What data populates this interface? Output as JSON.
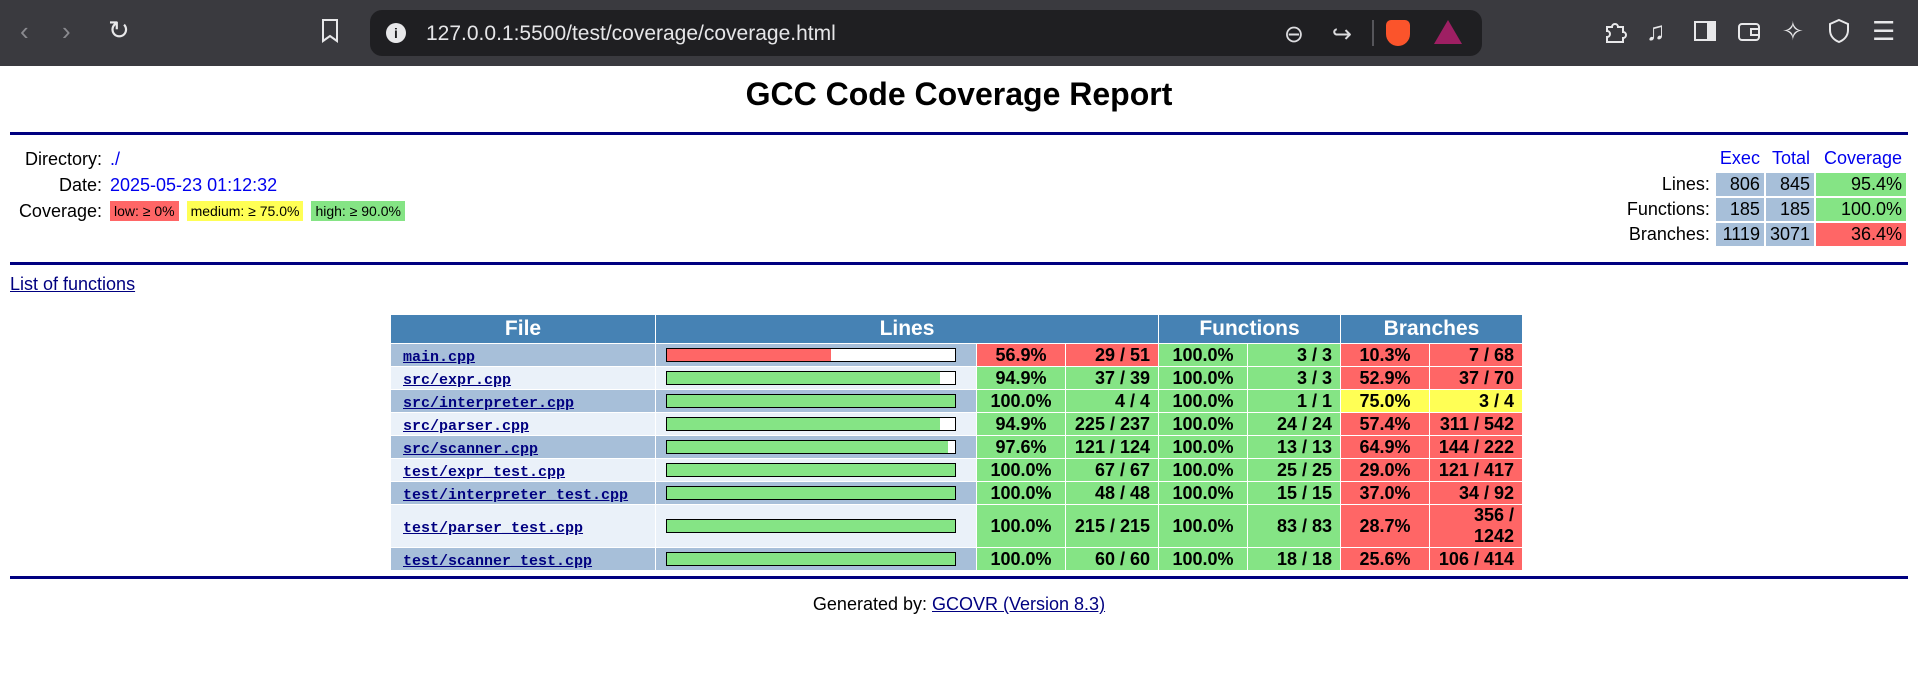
{
  "browser": {
    "url": "127.0.0.1:5500/test/coverage/coverage.html",
    "icons": [
      "back-icon",
      "forward-icon",
      "reload-icon",
      "bookmark-icon",
      "info-icon",
      "zoom-out-icon",
      "share-icon",
      "brave-shields-icon",
      "brave-rewards-icon",
      "extensions-icon",
      "media-icon",
      "sidebar-icon",
      "wallet-icon",
      "leo-ai-icon",
      "vpn-icon",
      "menu-icon"
    ]
  },
  "report": {
    "title": "GCC Code Coverage Report",
    "directory_label": "Directory:",
    "directory": "./",
    "date_label": "Date:",
    "date": "2025-05-23 01:12:32",
    "coverage_label": "Coverage:",
    "legend": {
      "low": "low: ≥ 0%",
      "medium": "medium: ≥ 75.0%",
      "high": "high: ≥ 90.0%"
    },
    "summary": {
      "headers": [
        "Exec",
        "Total",
        "Coverage"
      ],
      "rows": [
        {
          "label": "Lines:",
          "exec": "806",
          "total": "845",
          "coverage": "95.4%",
          "level": "hi"
        },
        {
          "label": "Functions:",
          "exec": "185",
          "total": "185",
          "coverage": "100.0%",
          "level": "hi"
        },
        {
          "label": "Branches:",
          "exec": "1119",
          "total": "3071",
          "coverage": "36.4%",
          "level": "lo"
        }
      ]
    },
    "list_of_functions": "List of functions",
    "table": {
      "headers": [
        "File",
        "Lines",
        "Functions",
        "Branches"
      ],
      "rows": [
        {
          "file": "main.cpp",
          "line_fraction": 0.569,
          "lines_pct": "56.9%",
          "lines": "29 / 51",
          "lines_level": "lo",
          "func_pct": "100.0%",
          "funcs": "3 / 3",
          "func_level": "hi",
          "br_pct": "10.3%",
          "branches": "7 / 68",
          "br_level": "lo"
        },
        {
          "file": "src/expr.cpp",
          "line_fraction": 0.949,
          "lines_pct": "94.9%",
          "lines": "37 / 39",
          "lines_level": "hi",
          "func_pct": "100.0%",
          "funcs": "3 / 3",
          "func_level": "hi",
          "br_pct": "52.9%",
          "branches": "37 / 70",
          "br_level": "lo"
        },
        {
          "file": "src/interpreter.cpp",
          "line_fraction": 1.0,
          "lines_pct": "100.0%",
          "lines": "4 / 4",
          "lines_level": "hi",
          "func_pct": "100.0%",
          "funcs": "1 / 1",
          "func_level": "hi",
          "br_pct": "75.0%",
          "branches": "3 / 4",
          "br_level": "md"
        },
        {
          "file": "src/parser.cpp",
          "line_fraction": 0.949,
          "lines_pct": "94.9%",
          "lines": "225 / 237",
          "lines_level": "hi",
          "func_pct": "100.0%",
          "funcs": "24 / 24",
          "func_level": "hi",
          "br_pct": "57.4%",
          "branches": "311 / 542",
          "br_level": "lo"
        },
        {
          "file": "src/scanner.cpp",
          "line_fraction": 0.976,
          "lines_pct": "97.6%",
          "lines": "121 / 124",
          "lines_level": "hi",
          "func_pct": "100.0%",
          "funcs": "13 / 13",
          "func_level": "hi",
          "br_pct": "64.9%",
          "branches": "144 / 222",
          "br_level": "lo"
        },
        {
          "file": "test/expr_test.cpp",
          "line_fraction": 1.0,
          "lines_pct": "100.0%",
          "lines": "67 / 67",
          "lines_level": "hi",
          "func_pct": "100.0%",
          "funcs": "25 / 25",
          "func_level": "hi",
          "br_pct": "29.0%",
          "branches": "121 / 417",
          "br_level": "lo"
        },
        {
          "file": "test/interpreter_test.cpp",
          "line_fraction": 1.0,
          "lines_pct": "100.0%",
          "lines": "48 / 48",
          "lines_level": "hi",
          "func_pct": "100.0%",
          "funcs": "15 / 15",
          "func_level": "hi",
          "br_pct": "37.0%",
          "branches": "34 / 92",
          "br_level": "lo"
        },
        {
          "file": "test/parser_test.cpp",
          "line_fraction": 1.0,
          "lines_pct": "100.0%",
          "lines": "215 / 215",
          "lines_level": "hi",
          "func_pct": "100.0%",
          "funcs": "83 / 83",
          "func_level": "hi",
          "br_pct": "28.7%",
          "branches": "356 / 1242",
          "br_level": "lo"
        },
        {
          "file": "test/scanner_test.cpp",
          "line_fraction": 1.0,
          "lines_pct": "100.0%",
          "lines": "60 / 60",
          "lines_level": "hi",
          "func_pct": "100.0%",
          "funcs": "18 / 18",
          "func_level": "hi",
          "br_pct": "25.6%",
          "branches": "106 / 414",
          "br_level": "lo"
        }
      ]
    },
    "footer": {
      "prefix": "Generated by: ",
      "link": "GCOVR (Version 8.3)"
    },
    "colors": {
      "low": "#ff6666",
      "medium": "#ffff55",
      "high": "#85e485",
      "header": "#4682b4",
      "rule": "#000080"
    }
  }
}
